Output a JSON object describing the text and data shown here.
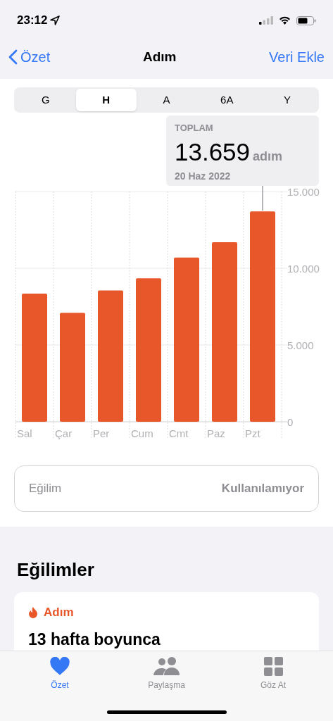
{
  "status_bar": {
    "time": "23:12"
  },
  "nav": {
    "back": "Özet",
    "title": "Adım",
    "action": "Veri Ekle"
  },
  "segments": [
    {
      "label": "G",
      "selected": false
    },
    {
      "label": "H",
      "selected": true
    },
    {
      "label": "A",
      "selected": false
    },
    {
      "label": "6A",
      "selected": false
    },
    {
      "label": "Y",
      "selected": false
    }
  ],
  "summary": {
    "label": "TOPLAM",
    "value": "13.659",
    "unit": "adım",
    "date": "20 Haz 2022"
  },
  "chart_data": {
    "type": "bar",
    "categories": [
      "Sal",
      "Çar",
      "Per",
      "Cum",
      "Cmt",
      "Paz",
      "Pzt"
    ],
    "series": [
      {
        "color": "#e8572a",
        "values": [
          8350,
          7100,
          8550,
          9350,
          10700,
          11700,
          13700
        ]
      }
    ],
    "ylim": [
      0,
      15000
    ],
    "yticks": [
      {
        "value": 0,
        "label": "0"
      },
      {
        "value": 5000,
        "label": "5.000"
      },
      {
        "value": 10000,
        "label": "10.000"
      },
      {
        "value": 15000,
        "label": "15.000"
      }
    ]
  },
  "trend": {
    "label": "Eğilim",
    "value": "Kullanılamıyor"
  },
  "trends_section": {
    "title": "Eğilimler",
    "card_title": "Adım",
    "headline": "13 hafta boyunca"
  },
  "tab_bar": [
    {
      "label": "Özet",
      "selected": true
    },
    {
      "label": "Paylaşma",
      "selected": false
    },
    {
      "label": "Göz At",
      "selected": false
    }
  ]
}
